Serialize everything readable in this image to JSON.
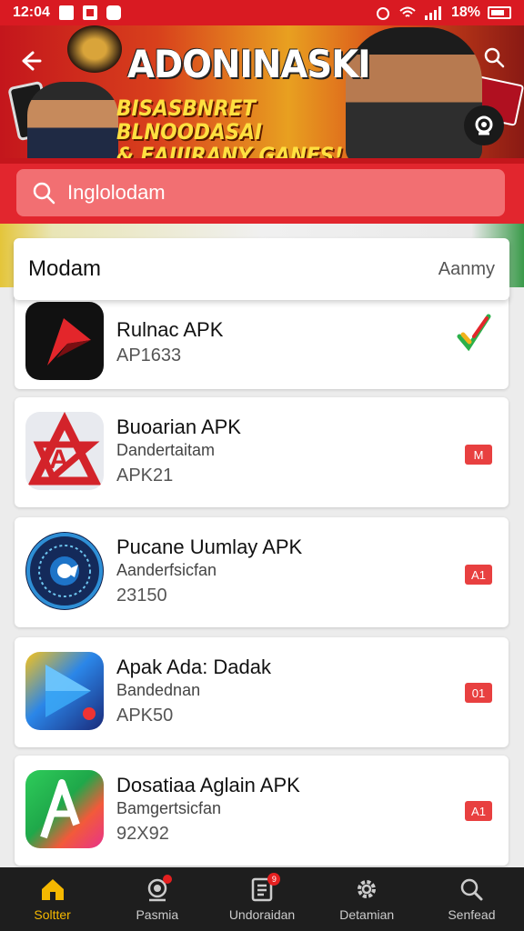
{
  "status_bar": {
    "time": "12:04",
    "battery": "18%"
  },
  "banner": {
    "title": "ADONINASKI",
    "subtitle_line1": "BISASBNRET BLNOODASAI",
    "subtitle_line2": "& EAIIIRANY GANES!"
  },
  "search": {
    "placeholder": "Inglolodam"
  },
  "list": {
    "header_title": "Modam",
    "header_sort": "Aanmy"
  },
  "apps": [
    {
      "name": "Rulnac APK",
      "sub": "",
      "meta": "AP1633",
      "badge": "",
      "verified": true
    },
    {
      "name": "Buoarian APK",
      "sub": "Dandertaitam",
      "meta": "APK21",
      "badge": "M"
    },
    {
      "name": "Pucane Uumlay APK",
      "sub": "Aanderfsicfan",
      "meta": "23150",
      "badge": "A1"
    },
    {
      "name": "Apak Ada: Dadak",
      "sub": "Bandednan",
      "meta": "APK50",
      "badge": "01"
    },
    {
      "name": "Dosatiaa Aglain APK",
      "sub": "Bamgertsicfan",
      "meta": "92X92",
      "badge": "A1"
    }
  ],
  "bottom_nav": [
    {
      "label": "Soltter",
      "icon": "home-icon",
      "active": true
    },
    {
      "label": "Pasmia",
      "icon": "podcast-icon"
    },
    {
      "label": "Undoraidan",
      "icon": "downloads-icon",
      "count": "9"
    },
    {
      "label": "Detamian",
      "icon": "gear-icon"
    },
    {
      "label": "Senfead",
      "icon": "search-icon"
    }
  ],
  "colors": {
    "primary": "#d91a22",
    "accent": "#f5b800",
    "nav_bg": "#1e1e1e"
  }
}
